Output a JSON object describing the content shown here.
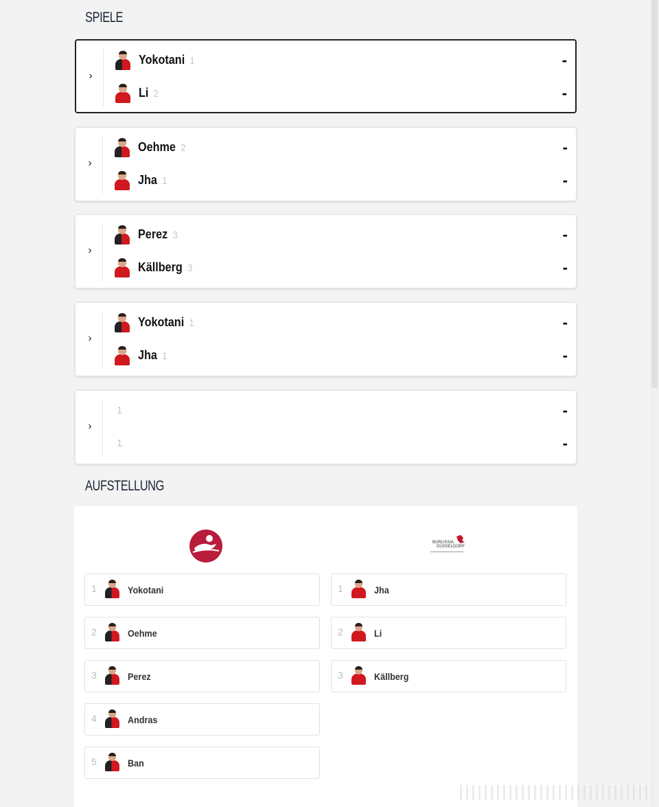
{
  "sections": {
    "games_title": "SPIELE",
    "lineup_title": "AUFSTELLUNG"
  },
  "colors": {
    "home_red": "#d0181f",
    "home_logo": "#b81d3c",
    "score_text": "#000000"
  },
  "matches": [
    {
      "active": true,
      "chevron": "›",
      "home": {
        "name": "Yokotani",
        "number": "1",
        "shirt": "black"
      },
      "away": {
        "name": "Li",
        "number": "2",
        "shirt": "red"
      },
      "home_score": "-",
      "away_score": "-"
    },
    {
      "active": false,
      "chevron": "›",
      "home": {
        "name": "Oehme",
        "number": "2",
        "shirt": "black"
      },
      "away": {
        "name": "Jha",
        "number": "1",
        "shirt": "red"
      },
      "home_score": "-",
      "away_score": "-"
    },
    {
      "active": false,
      "chevron": "›",
      "home": {
        "name": "Perez",
        "number": "3",
        "shirt": "black"
      },
      "away": {
        "name": "Källberg",
        "number": "3",
        "shirt": "red"
      },
      "home_score": "-",
      "away_score": "-"
    },
    {
      "active": false,
      "chevron": "›",
      "home": {
        "name": "Yokotani",
        "number": "1",
        "shirt": "black"
      },
      "away": {
        "name": "Jha",
        "number": "1",
        "shirt": "red"
      },
      "home_score": "-",
      "away_score": "-"
    },
    {
      "active": false,
      "chevron": "›",
      "home": {
        "name": "",
        "number": "1",
        "shirt": ""
      },
      "away": {
        "name": "",
        "number": "1",
        "shirt": ""
      },
      "home_score": "-",
      "away_score": "-"
    }
  ],
  "lineup": {
    "away_logo_text_line1": "BORUSSIA",
    "away_logo_text_line2": "DÜSSELDORF",
    "home": [
      {
        "number": "1",
        "name": "Yokotani"
      },
      {
        "number": "2",
        "name": "Oehme"
      },
      {
        "number": "3",
        "name": "Perez"
      },
      {
        "number": "4",
        "name": "Andras"
      },
      {
        "number": "5",
        "name": "Ban"
      }
    ],
    "away": [
      {
        "number": "1",
        "name": "Jha"
      },
      {
        "number": "2",
        "name": "Li"
      },
      {
        "number": "3",
        "name": "Källberg"
      }
    ]
  }
}
